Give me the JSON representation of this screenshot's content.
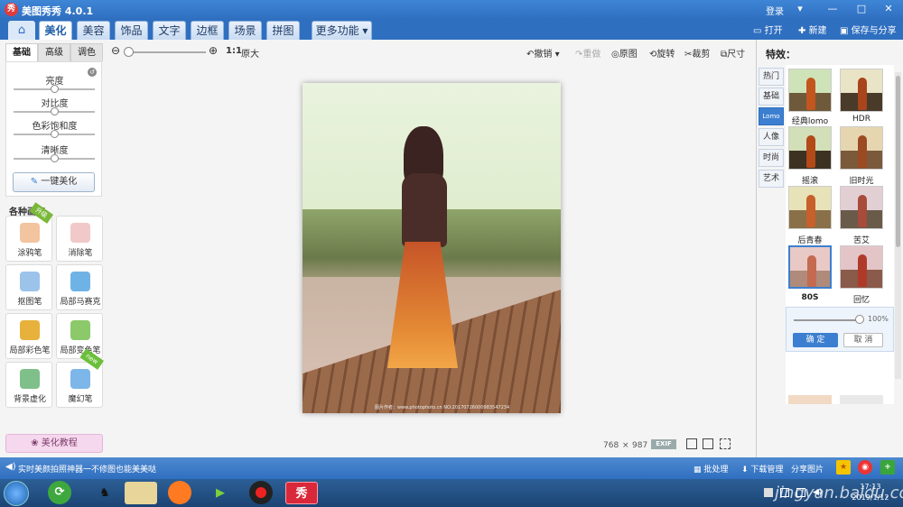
{
  "app": {
    "title": "美图秀秀 4.0.1",
    "login": "登录"
  },
  "window_buttons": [
    "▾",
    "—",
    "□",
    "✕"
  ],
  "menu": {
    "tabs": [
      "美化",
      "美容",
      "饰品",
      "文字",
      "边框",
      "场景",
      "拼图",
      "更多功能 ▾"
    ],
    "active": "美化"
  },
  "top_actions": {
    "open": "打开",
    "new": "新建",
    "save": "保存与分享"
  },
  "toolbar": {
    "ratio": "1:1",
    "original_size": "原大",
    "undo": "撤销",
    "redo": "重做",
    "original": "原图",
    "rotate": "旋转",
    "crop": "裁剪",
    "resize": "尺寸",
    "zoom_fraction": 0.0
  },
  "left_panel": {
    "tabs": [
      "基础",
      "高级",
      "调色"
    ],
    "sliders": [
      {
        "label": "亮度",
        "value": 0.5
      },
      {
        "label": "对比度",
        "value": 0.5
      },
      {
        "label": "色彩饱和度",
        "value": 0.5
      },
      {
        "label": "清晰度",
        "value": 0.5
      }
    ],
    "one_key": "一键美化",
    "brushes_title": "各种画笔",
    "brushes": [
      {
        "label": "涂鸦笔",
        "badge": "升级"
      },
      {
        "label": "消除笔",
        "badge": ""
      },
      {
        "label": "抠图笔",
        "badge": ""
      },
      {
        "label": "局部马赛克",
        "badge": ""
      },
      {
        "label": "局部彩色笔",
        "badge": ""
      },
      {
        "label": "局部变色笔",
        "badge": ""
      },
      {
        "label": "背景虚化",
        "badge": ""
      },
      {
        "label": "魔幻笔",
        "badge": "new"
      }
    ],
    "tutorial": "美化教程"
  },
  "canvas": {
    "image_width": "768",
    "times": "×",
    "image_height": "987",
    "exif": "EXIF",
    "photo_watermark": "图片作者：www.photophoto.cn  NO:20170726000983547234"
  },
  "right_panel": {
    "title": "特效：",
    "categories": [
      "热门",
      "基础",
      "Lomo",
      "人像",
      "时尚",
      "艺术"
    ],
    "active_category": "Lomo",
    "effects": [
      {
        "label": "经典lomo"
      },
      {
        "label": "HDR"
      },
      {
        "label": "摇滚"
      },
      {
        "label": "旧时光"
      },
      {
        "label": "后青春"
      },
      {
        "label": "苦艾"
      },
      {
        "label": "80S"
      },
      {
        "label": "回忆"
      }
    ],
    "selected_effect": "80S",
    "opacity": "100%",
    "ok": "确 定",
    "cancel": "取 消"
  },
  "status": {
    "message": "实时美颜拍照神器一不修图也能美美哒",
    "batch": "批处理",
    "download": "下载管理",
    "share": "分享图片"
  },
  "taskbar": {
    "time": "17:13",
    "date": "2019/1/12"
  },
  "screen_watermark": "jingyan.baidu.com",
  "colors": {
    "accent": "#2f6fc0",
    "selected": "#3c7fd0"
  }
}
